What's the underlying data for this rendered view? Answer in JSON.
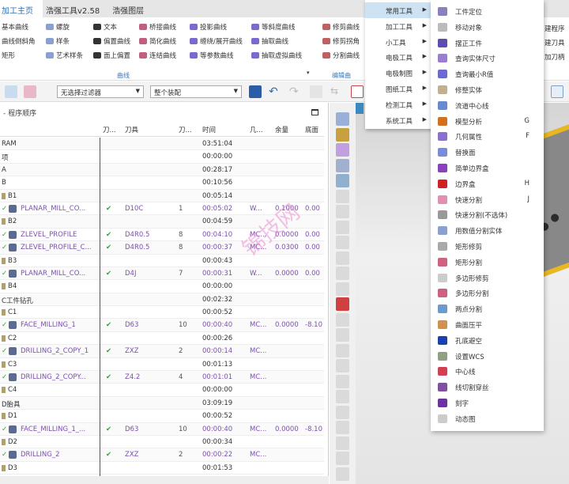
{
  "tabs": [
    "加工主页",
    "浩强工具v2.58",
    "浩强图层"
  ],
  "ribbon": {
    "col1": [
      "基本曲线",
      "曲线倒斜角",
      "矩形"
    ],
    "col2": [
      "螺旋",
      "样条",
      "艺术样条"
    ],
    "col3": [
      "文本",
      "偏置曲线",
      "面上偏置"
    ],
    "col4": [
      "桥接曲线",
      "简化曲线",
      "连结曲线"
    ],
    "col5": [
      "投影曲线",
      "缠绕/展开曲线",
      "等参数曲线"
    ],
    "col6": [
      "等斜度曲线",
      "抽取曲线",
      "抽取虚拟曲线"
    ],
    "col7": [
      "修剪曲线",
      "修剪拐角",
      "分割曲线"
    ],
    "right_partial": [
      "建程序",
      "建刀具",
      "加刀柄"
    ],
    "group_curve": "曲线",
    "group_edit": "编辑曲"
  },
  "toolbar": {
    "filter": "无选择过滤器",
    "scope": "整个装配"
  },
  "panel": {
    "title": "- 程序顺序",
    "columns": [
      "刀...",
      "刀具",
      "刀...",
      "时间",
      "几...",
      "余量",
      "底面"
    ],
    "rows": [
      {
        "name": "RAM",
        "time": "03:51:04"
      },
      {
        "name": "项",
        "time": "00:00:00"
      },
      {
        "name": "A",
        "time": "00:28:17"
      },
      {
        "name": "B",
        "time": "00:10:56"
      },
      {
        "name": "B1",
        "time": "00:05:14",
        "group": true
      },
      {
        "name": "PLANAR_MILL_CO...",
        "op": true,
        "tool": "D10C",
        "num": "1",
        "time": "00:05:02",
        "geo": "W...",
        "stock": "0.1000",
        "floor": "0.00"
      },
      {
        "name": "B2",
        "time": "00:04:59",
        "group": true
      },
      {
        "name": "ZLEVEL_PROFILE",
        "op": true,
        "tool": "D4R0.5",
        "num": "8",
        "time": "00:04:10",
        "geo": "MC...",
        "stock": "0.0000",
        "floor": "0.00"
      },
      {
        "name": "ZLEVEL_PROFILE_C...",
        "op": true,
        "tool": "D4R0.5",
        "num": "8",
        "time": "00:00:37",
        "geo": "MC...",
        "stock": "0.0300",
        "floor": "0.00"
      },
      {
        "name": "B3",
        "time": "00:00:43",
        "group": true
      },
      {
        "name": "PLANAR_MILL_CO...",
        "op": true,
        "tool": "D4J",
        "num": "7",
        "time": "00:00:31",
        "geo": "W...",
        "stock": "0.0000",
        "floor": "0.00"
      },
      {
        "name": "B4",
        "time": "00:00:00",
        "group": true
      },
      {
        "name": "C工件钻孔",
        "time": "00:02:32"
      },
      {
        "name": "C1",
        "time": "00:00:52",
        "group": true
      },
      {
        "name": "FACE_MILLING_1",
        "op": true,
        "tool": "D63",
        "num": "10",
        "time": "00:00:40",
        "geo": "MC...",
        "stock": "0.0000",
        "floor": "-8.10"
      },
      {
        "name": "C2",
        "time": "00:00:26",
        "group": true
      },
      {
        "name": "DRILLING_2_COPY_1",
        "op": true,
        "tool": "ZXZ",
        "num": "2",
        "time": "00:00:14",
        "geo": "MC..."
      },
      {
        "name": "C3",
        "time": "00:01:13",
        "group": true
      },
      {
        "name": "DRILLING_2_COPY...",
        "op": true,
        "tool": "Z4.2",
        "num": "4",
        "time": "00:01:01",
        "geo": "MC..."
      },
      {
        "name": "C4",
        "time": "00:00:00",
        "group": true
      },
      {
        "name": "D胎具",
        "time": "03:09:19"
      },
      {
        "name": "D1",
        "time": "00:00:52",
        "group": true
      },
      {
        "name": "FACE_MILLING_1_...",
        "op": true,
        "tool": "D63",
        "num": "10",
        "time": "00:00:40",
        "geo": "MC...",
        "stock": "0.0000",
        "floor": "-8.10"
      },
      {
        "name": "D2",
        "time": "00:00:34",
        "group": true
      },
      {
        "name": "DRILLING_2",
        "op": true,
        "tool": "ZXZ",
        "num": "2",
        "time": "00:00:22",
        "geo": "MC..."
      },
      {
        "name": "D3",
        "time": "00:01:53",
        "group": true
      }
    ]
  },
  "menu1": [
    "常用工具",
    "加工工具",
    "小工具",
    "电极工具",
    "电极制图",
    "图纸工具",
    "检测工具",
    "系统工具"
  ],
  "menu2": [
    {
      "label": "工件定位",
      "color": "#8a7fc0"
    },
    {
      "label": "移动对象",
      "color": "#bbbbbb"
    },
    {
      "label": "摆正工件",
      "color": "#5a4fb0"
    },
    {
      "label": "查询实体尺寸",
      "color": "#9a7fd0"
    },
    {
      "label": "查询最小R值",
      "color": "#6a6ad0"
    },
    {
      "label": "修整实体",
      "color": "#c0b090"
    },
    {
      "label": "流道中心线",
      "color": "#6a8ad0"
    },
    {
      "label": "模型分析",
      "color": "#d07020",
      "shortcut": "G"
    },
    {
      "label": "几何属性",
      "color": "#8a70d0",
      "shortcut": "F"
    },
    {
      "label": "替换面",
      "color": "#7a8ae0"
    },
    {
      "label": "简单边界盒",
      "color": "#8a40c0"
    },
    {
      "label": "边界盒",
      "color": "#d02020",
      "shortcut": "H"
    },
    {
      "label": "快速分割",
      "color": "#e090b0",
      "shortcut": "J"
    },
    {
      "label": "快速分割(不选体)",
      "color": "#999999"
    },
    {
      "label": "用数值分割实体",
      "color": "#8aa0d0"
    },
    {
      "label": "矩形修剪",
      "color": "#aaaaaa"
    },
    {
      "label": "矩形分割",
      "color": "#d06080"
    },
    {
      "label": "多边形修剪",
      "color": "#cccccc"
    },
    {
      "label": "多边形分割",
      "color": "#d06080"
    },
    {
      "label": "两点分割",
      "color": "#6a9ad0"
    },
    {
      "label": "曲面压平",
      "color": "#d09050"
    },
    {
      "label": "孔底避空",
      "color": "#1a40b0"
    },
    {
      "label": "设置WCS",
      "color": "#90a080"
    },
    {
      "label": "中心线",
      "color": "#d04050"
    },
    {
      "label": "线切割穿丝",
      "color": "#8050a0"
    },
    {
      "label": "刻字",
      "color": "#7030a0"
    },
    {
      "label": "动态图",
      "color": "#cccccc"
    }
  ],
  "watermark": "锦技网",
  "colors": {
    "accent": "#2a6fb5",
    "operation": "#7b4fae",
    "check": "#2aa52a",
    "menu_highlight": "#cde3f3"
  }
}
